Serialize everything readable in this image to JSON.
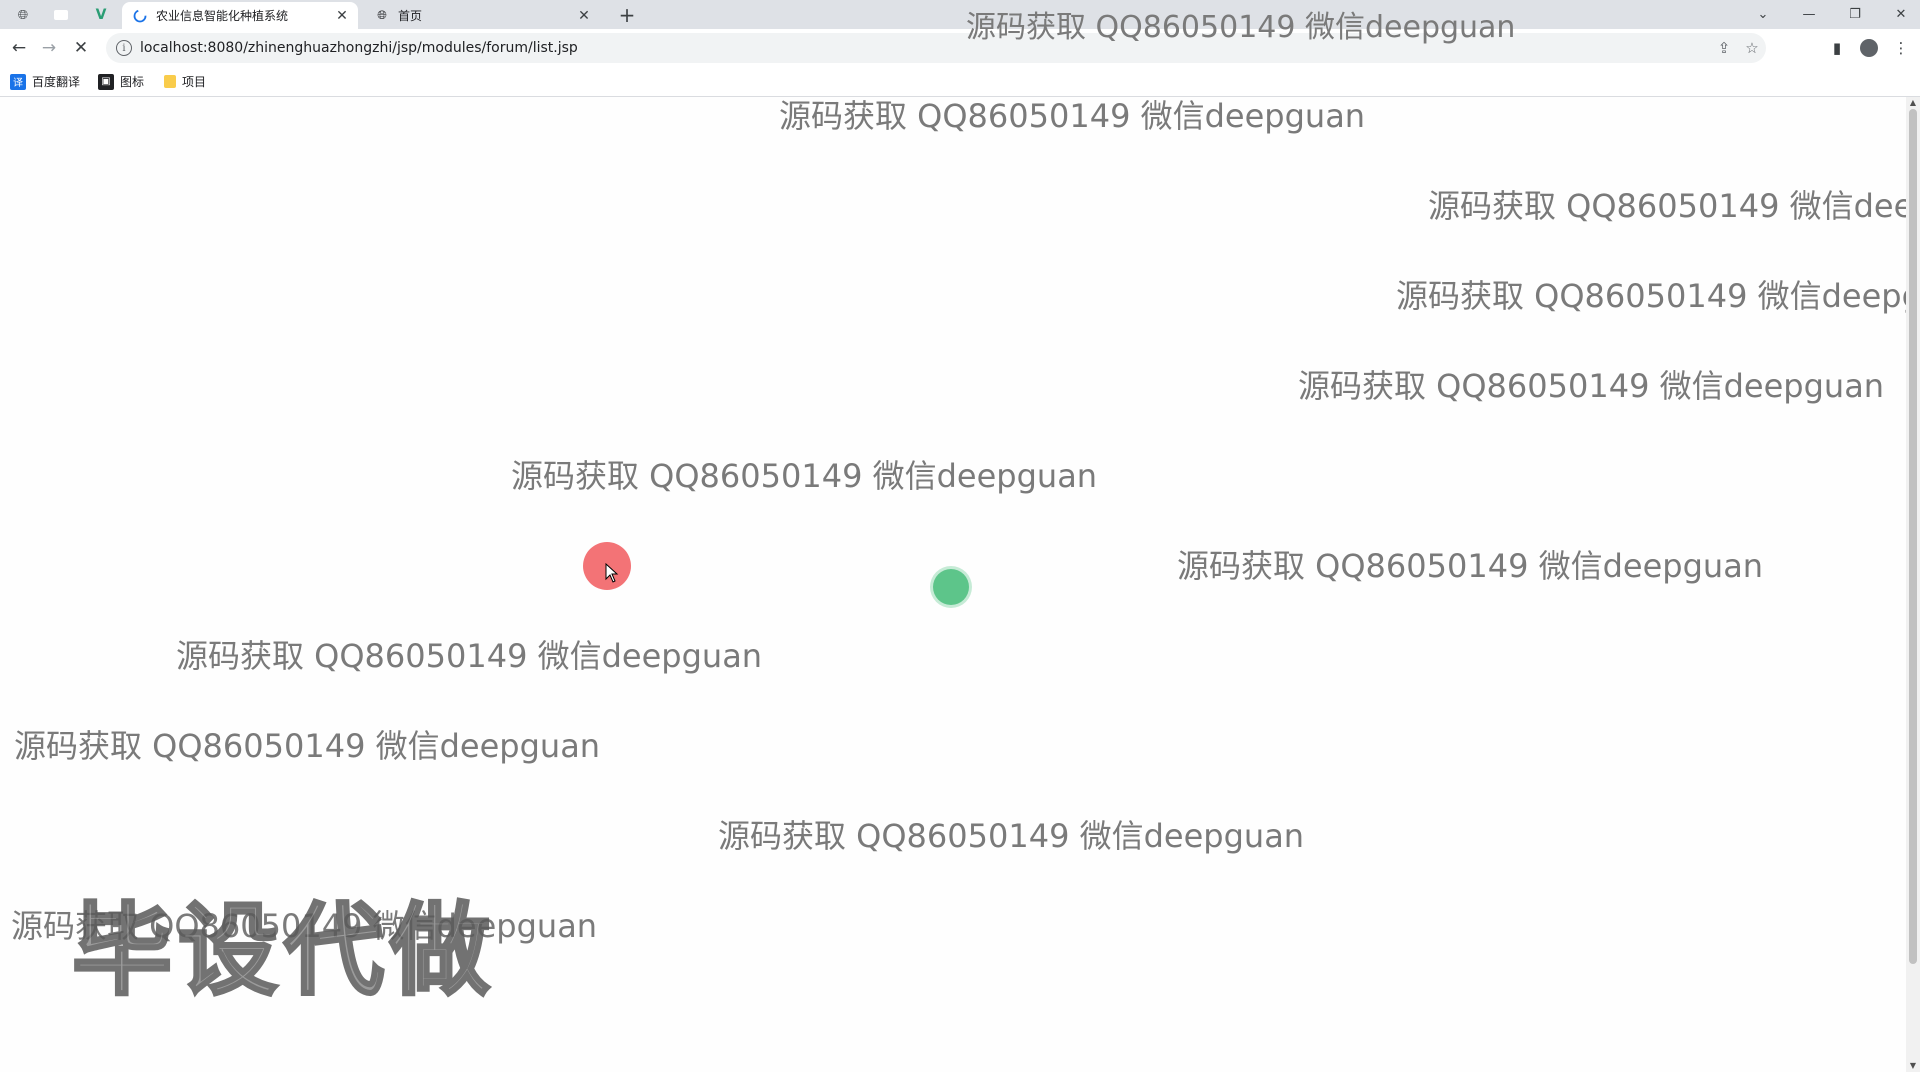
{
  "browser": {
    "tabs": [
      {
        "title": "农业信息智能化种植系统",
        "active": true,
        "loading": true
      },
      {
        "title": "首页",
        "active": false,
        "loading": false
      }
    ],
    "address_bar": {
      "url": "localhost:8080/zhinenghuazhongzhi/jsp/modules/forum/list.jsp"
    },
    "bookmarks": [
      {
        "label": "百度翻译",
        "icon": "translate-icon",
        "color": "#1a73e8"
      },
      {
        "label": "图标",
        "icon": "image-icon",
        "color": "#202124"
      },
      {
        "label": "项目",
        "icon": "folder-icon",
        "color": "#f9cc4b"
      }
    ]
  },
  "overlay": {
    "watermark_text": "源码获取 QQ86050149 微信deepguan",
    "big_stamp": "毕设代做"
  },
  "colors": {
    "tabstrip_bg": "#dee1e6",
    "click_indicator": "#f26b6f",
    "secondary_indicator": "#4cbf7e"
  }
}
